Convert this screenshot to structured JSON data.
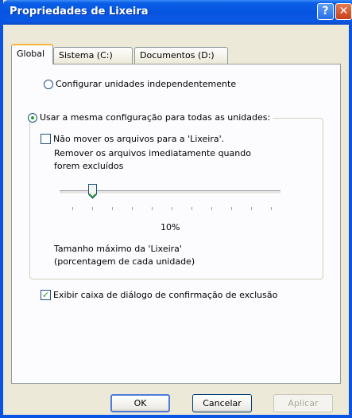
{
  "window": {
    "title": "Propriedades de Lixeira",
    "help_label": "?",
    "close_label": "✕"
  },
  "tabs": [
    {
      "label": "Global",
      "active": true
    },
    {
      "label": "Sistema (C:)",
      "active": false
    },
    {
      "label": "Documentos (D:)",
      "active": false
    }
  ],
  "global": {
    "radio_independent": {
      "label": "Configurar unidades independentemente",
      "checked": false
    },
    "radio_same": {
      "label": "Usar a mesma configuração para todas as unidades:",
      "checked": true
    },
    "no_move": {
      "label_line1": "Não mover os arquivos para a 'Lixeira'.",
      "label_line2": "Remover os arquivos imediatamente quando",
      "label_line3": "forem excluídos",
      "checked": false
    },
    "slider": {
      "value_label": "10%",
      "value_percent": 10
    },
    "max_size_line1": "Tamanho máximo da 'Lixeira'",
    "max_size_line2": "(porcentagem de cada unidade)",
    "confirm_dialog": {
      "label": "Exibir caixa de diálogo de confirmação de exclusão",
      "checked": true
    }
  },
  "buttons": {
    "ok": "OK",
    "cancel": "Cancelar",
    "apply": "Aplicar"
  }
}
